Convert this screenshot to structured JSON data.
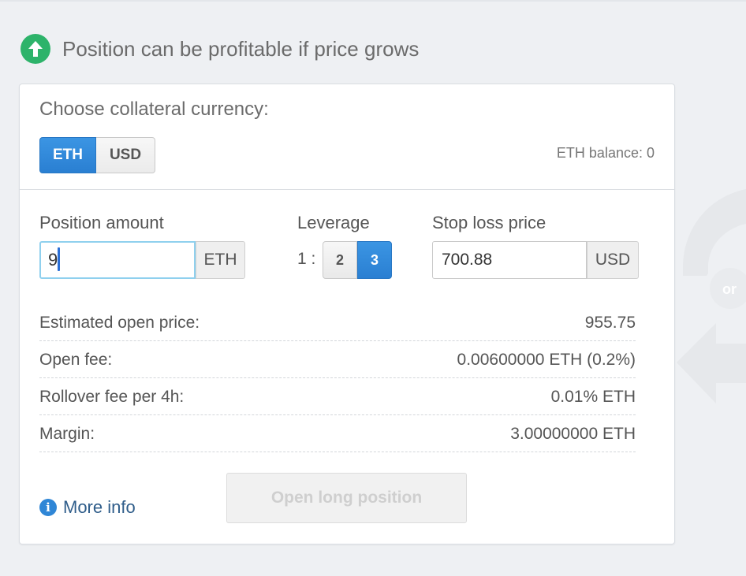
{
  "header": {
    "icon": "arrow-up-icon",
    "icon_color": "#2db36a",
    "text": "Position can be profitable if price grows"
  },
  "collateral": {
    "label": "Choose collateral currency:",
    "options": [
      "ETH",
      "USD"
    ],
    "selected": "ETH",
    "balance_text": "ETH balance: 0"
  },
  "position_amount": {
    "label": "Position amount",
    "value": "9",
    "unit": "ETH"
  },
  "leverage": {
    "label": "Leverage",
    "prefix": "1 :",
    "options": [
      "2",
      "3"
    ],
    "selected": "3"
  },
  "stop_loss": {
    "label": "Stop loss price",
    "value": "700.88",
    "unit": "USD"
  },
  "summary": [
    {
      "label": "Estimated open price:",
      "value": "955.75"
    },
    {
      "label": "Open fee:",
      "value": "0.00600000 ETH (0.2%)"
    },
    {
      "label": "Rollover fee per 4h:",
      "value": "0.01% ETH"
    },
    {
      "label": "Margin:",
      "value": "3.00000000 ETH"
    }
  ],
  "more_info": {
    "icon": "info-icon",
    "label": "More info"
  },
  "open_button": {
    "label": "Open long position",
    "enabled": false
  },
  "side_decoration": {
    "label": "or"
  },
  "colors": {
    "accent": "#2a7fd2",
    "success": "#2db36a",
    "link": "#2f5d8a"
  }
}
